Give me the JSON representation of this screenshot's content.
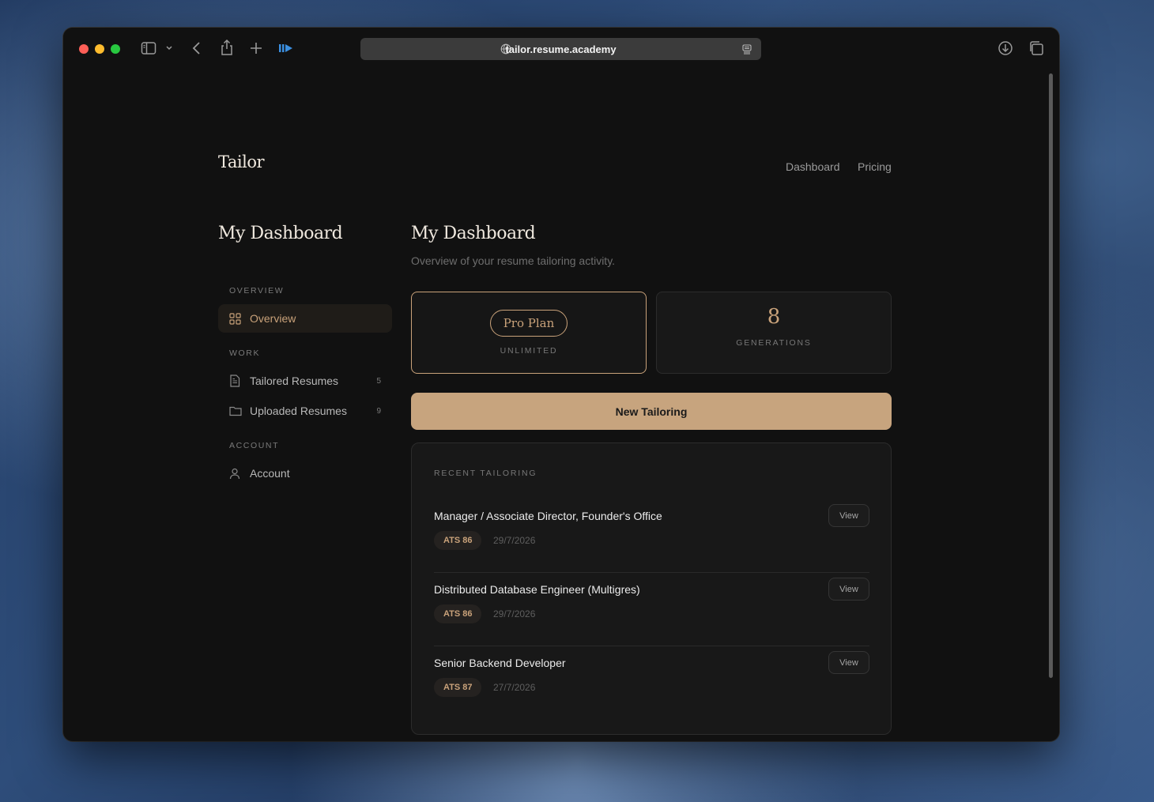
{
  "browser": {
    "url": "tailor.resume.academy"
  },
  "header": {
    "logo": "Tailor",
    "nav": [
      {
        "label": "Dashboard"
      },
      {
        "label": "Pricing"
      }
    ]
  },
  "sidebar": {
    "title": "My Dashboard",
    "sections": [
      {
        "label": "OVERVIEW"
      },
      {
        "label": "WORK"
      },
      {
        "label": "ACCOUNT"
      }
    ],
    "items": [
      {
        "label": "Overview",
        "active": true
      },
      {
        "label": "Tailored Resumes",
        "count": "5"
      },
      {
        "label": "Uploaded Resumes",
        "count": "9"
      },
      {
        "label": "Account"
      }
    ]
  },
  "main": {
    "title": "My Dashboard",
    "subtitle": "Overview of your resume tailoring activity.",
    "plan": {
      "name": "Pro Plan",
      "detail": "UNLIMITED"
    },
    "generations": {
      "count": "8",
      "label": "GENERATIONS"
    },
    "new_button": "New Tailoring",
    "recent": {
      "label": "RECENT TAILORING",
      "rows": [
        {
          "title": "Manager / Associate Director, Founder's Office",
          "ats": "ATS 86",
          "date": "29/7/2026",
          "view": "View"
        },
        {
          "title": "Distributed Database Engineer (Multigres)",
          "ats": "ATS 86",
          "date": "29/7/2026",
          "view": "View"
        },
        {
          "title": "Senior Backend Developer",
          "ats": "ATS 87",
          "date": "27/7/2026",
          "view": "View"
        }
      ]
    }
  },
  "colors": {
    "accent": "#c9a27a",
    "button": "#c7a47e",
    "background": "#111111",
    "card": "#181818"
  },
  "icons": [
    "sidebar-toggle-icon",
    "chevron-down-icon",
    "back-icon",
    "share-icon",
    "plus-icon",
    "extension-icon",
    "globe-icon",
    "reader-icon",
    "download-icon",
    "tabs-icon",
    "grid-icon",
    "document-icon",
    "folder-icon",
    "user-icon"
  ]
}
